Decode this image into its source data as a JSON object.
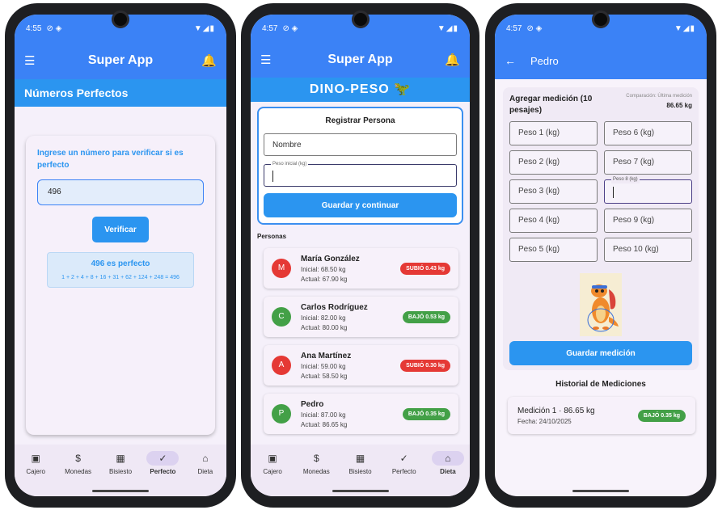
{
  "colors": {
    "primary": "#3b82f6",
    "accent": "#2b95f0",
    "up": "#e53935",
    "down": "#43a047"
  },
  "phone1": {
    "status_time": "4:55",
    "app_title": "Super App",
    "section_title": "Números Perfectos",
    "prompt": "Ingrese un número para verificar si es perfecto",
    "input_value": "496",
    "verify_label": "Verificar",
    "result_title": "496 es perfecto",
    "result_sum": "1 + 2 + 4 + 8 + 16 + 31 + 62 + 124 + 248 = 496"
  },
  "nav": {
    "items": [
      {
        "label": "Cajero",
        "icon": "atm-icon"
      },
      {
        "label": "Monedas",
        "icon": "currency-icon"
      },
      {
        "label": "Bisiesto",
        "icon": "calendar-icon"
      },
      {
        "label": "Perfecto",
        "icon": "check-icon"
      },
      {
        "label": "Dieta",
        "icon": "diet-icon"
      }
    ]
  },
  "phone2": {
    "status_time": "4:57",
    "app_title": "Super App",
    "header": "DINO-PESO 🦖",
    "register_title": "Registrar Persona",
    "name_placeholder": "Nombre",
    "weight_label": "Peso inicial (kg)",
    "save_label": "Guardar y continuar",
    "people_label": "Personas",
    "people": [
      {
        "initial": "M",
        "name": "María González",
        "inicial": "Inicial: 68.50 kg",
        "actual": "Actual: 67.90 kg",
        "badge": "SUBIÓ 0.43 kg",
        "trend": "up"
      },
      {
        "initial": "C",
        "name": "Carlos Rodríguez",
        "inicial": "Inicial: 82.00 kg",
        "actual": "Actual: 80.00 kg",
        "badge": "BAJÓ 0.53 kg",
        "trend": "down"
      },
      {
        "initial": "A",
        "name": "Ana Martínez",
        "inicial": "Inicial: 59.00 kg",
        "actual": "Actual: 58.50 kg",
        "badge": "SUBIÓ 0.30 kg",
        "trend": "up"
      },
      {
        "initial": "P",
        "name": "Pedro",
        "inicial": "Inicial: 87.00 kg",
        "actual": "Actual: 86.65 kg",
        "badge": "BAJÓ 0.35 kg",
        "trend": "down"
      }
    ]
  },
  "phone3": {
    "status_time": "4:57",
    "title": "Pedro",
    "card_title": "Agregar medición (10 pesajes)",
    "compare_label": "Comparación: Última medición",
    "compare_value": "86.65 kg",
    "weights": [
      "Peso 1 (kg)",
      "Peso 6 (kg)",
      "Peso 2 (kg)",
      "Peso 7 (kg)",
      "Peso 3 (kg)",
      "Peso 8 (kg)",
      "Peso 4 (kg)",
      "Peso 9 (kg)",
      "Peso 5 (kg)",
      "Peso 10 (kg)"
    ],
    "save_label": "Guardar medición",
    "history_title": "Historial de Mediciones",
    "history": [
      {
        "title": "Medición 1 · 86.65 kg",
        "date": "Fecha: 24/10/2025",
        "badge": "BAJÓ 0.35 kg"
      }
    ]
  }
}
